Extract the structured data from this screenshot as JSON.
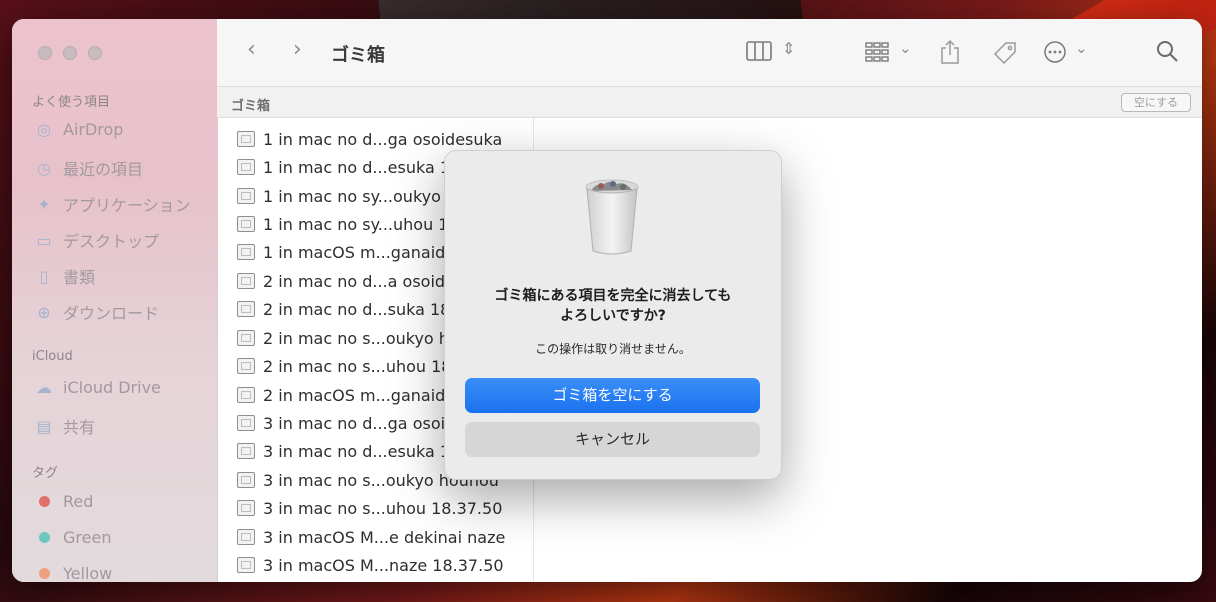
{
  "window": {
    "title": "ゴミ箱"
  },
  "sidebar": {
    "favorites_header": "よく使う項目",
    "favorites": [
      {
        "label": "AirDrop",
        "icon": "airdrop-icon"
      },
      {
        "label": "最近の項目",
        "icon": "clock-icon"
      },
      {
        "label": "アプリケーション",
        "icon": "applications-icon"
      },
      {
        "label": "デスクトップ",
        "icon": "desktop-icon"
      },
      {
        "label": "書類",
        "icon": "document-icon"
      },
      {
        "label": "ダウンロード",
        "icon": "download-icon"
      }
    ],
    "icloud_header": "iCloud",
    "icloud": [
      {
        "label": "iCloud Drive",
        "icon": "cloud-icon"
      },
      {
        "label": "共有",
        "icon": "shared-folder-icon"
      }
    ],
    "tags_header": "タグ",
    "tags": [
      {
        "label": "Red",
        "color": "#e0706a"
      },
      {
        "label": "Green",
        "color": "#6ec6c0"
      },
      {
        "label": "Yellow",
        "color": "#f0a080"
      }
    ]
  },
  "pathbar": {
    "crumb": "ゴミ箱",
    "empty_button": "空にする"
  },
  "files": [
    "1 in mac no d...ga osoidesuka",
    "1 in mac no d...esuka 18",
    "1 in mac no sy...oukyo h",
    "1 in mac no sy...uhou 18",
    "1 in macOS m...ganaide",
    "2  in mac no d...a osoid",
    "2  in mac no d...suka 18",
    "2 in mac no s...oukyo h",
    "2 in mac no s...uhou 18",
    "2 in macOS m...ganaide",
    "3 in mac no d...ga osoi",
    "3 in mac no d...esuka 1",
    "3 in mac no s...oukyo hounou",
    "3 in mac no s...uhou 18.37.50",
    "3 in macOS M...e dekinai naze",
    "3 in macOS M...naze 18.37.50"
  ],
  "dialog": {
    "title": "ゴミ箱にある項目を完全に消去しても\nよろしいですか?",
    "message": "この操作は取り消せません。",
    "confirm_label": "ゴミ箱を空にする",
    "cancel_label": "キャンセル"
  }
}
